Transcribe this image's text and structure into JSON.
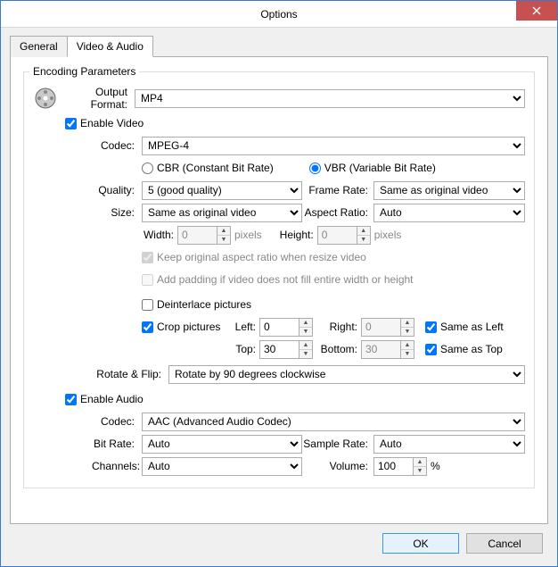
{
  "window": {
    "title": "Options"
  },
  "tabs": {
    "general": "General",
    "videoaudio": "Video & Audio"
  },
  "group": {
    "title": "Encoding Parameters"
  },
  "labels": {
    "output_format": "Output Format:",
    "enable_video": "Enable Video",
    "codec": "Codec:",
    "quality": "Quality:",
    "size": "Size:",
    "frame_rate": "Frame Rate:",
    "aspect_ratio": "Aspect Ratio:",
    "width": "Width:",
    "height": "Height:",
    "pixels": "pixels",
    "keep_aspect": "Keep original aspect ratio when resize video",
    "add_padding": "Add padding if video does not fill entire width or height",
    "deinterlace": "Deinterlace pictures",
    "crop_pictures": "Crop pictures",
    "left": "Left:",
    "right": "Right:",
    "top": "Top:",
    "bottom": "Bottom:",
    "same_as_left": "Same as Left",
    "same_as_top": "Same as Top",
    "rotate_flip": "Rotate & Flip:",
    "enable_audio": "Enable Audio",
    "bit_rate": "Bit Rate:",
    "channels": "Channels:",
    "sample_rate": "Sample Rate:",
    "volume": "Volume:",
    "percent": "%",
    "cbr": "CBR (Constant Bit Rate)",
    "vbr": "VBR (Variable Bit Rate)"
  },
  "values": {
    "output_format": "MP4",
    "enable_video": true,
    "video_codec": "MPEG-4",
    "rate_mode": "vbr",
    "quality": "5 (good quality)",
    "frame_rate": "Same as original video",
    "size": "Same as original video",
    "aspect_ratio": "Auto",
    "width": "0",
    "height": "0",
    "keep_aspect": true,
    "add_padding": false,
    "deinterlace": false,
    "crop_pictures": true,
    "crop_left": "0",
    "crop_right": "0",
    "crop_top": "30",
    "crop_bottom": "30",
    "same_as_left": true,
    "same_as_top": true,
    "rotate_flip": "Rotate by 90 degrees clockwise",
    "enable_audio": true,
    "audio_codec": "AAC (Advanced Audio Codec)",
    "audio_bitrate": "Auto",
    "sample_rate": "Auto",
    "channels": "Auto",
    "volume": "100"
  },
  "buttons": {
    "ok": "OK",
    "cancel": "Cancel"
  }
}
